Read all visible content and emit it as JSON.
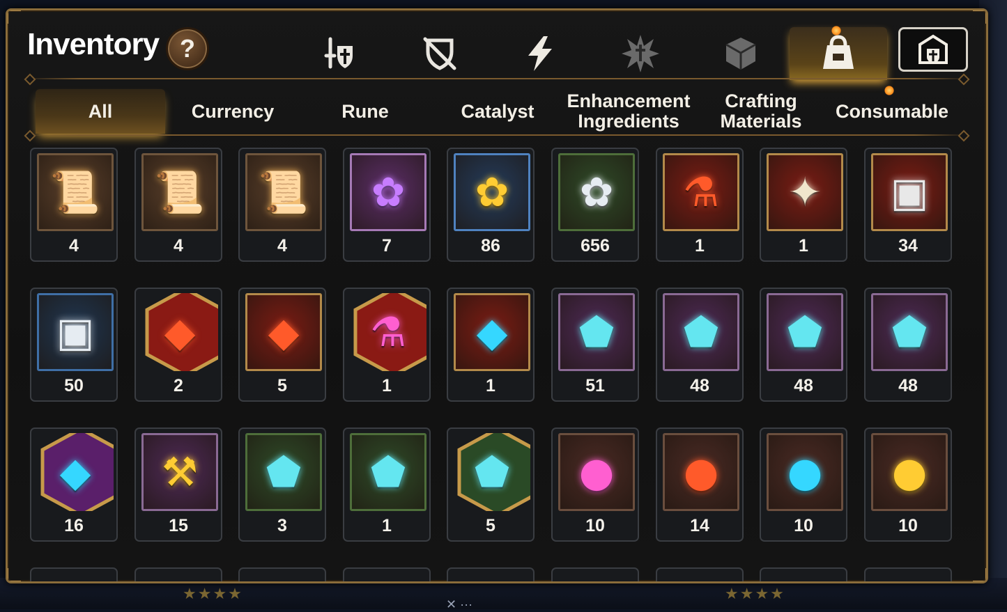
{
  "header": {
    "title": "Inventory",
    "help_label": "?"
  },
  "category_tabs": [
    {
      "name": "hero-equipment",
      "icon": "knight-shield-icon",
      "active": false
    },
    {
      "name": "no-equipment",
      "icon": "crossed-shield-icon",
      "active": false
    },
    {
      "name": "energy",
      "icon": "lightning-icon",
      "active": false
    },
    {
      "name": "artifacts",
      "icon": "burst-icon",
      "active": false
    },
    {
      "name": "materials",
      "icon": "cube-icon",
      "active": false
    },
    {
      "name": "bag",
      "icon": "bag-icon",
      "active": true
    },
    {
      "name": "storage",
      "icon": "vault-icon",
      "active": false
    }
  ],
  "sub_tabs": [
    {
      "label": "All",
      "active": true
    },
    {
      "label": "Currency",
      "active": false
    },
    {
      "label": "Rune",
      "active": false
    },
    {
      "label": "Catalyst",
      "active": false
    },
    {
      "label": "Enhancement\nIngredients",
      "active": false
    },
    {
      "label": "Crafting\nMaterials",
      "active": false
    },
    {
      "label": "Consumable",
      "active": false
    }
  ],
  "items": [
    [
      {
        "icon": "scroll-orange-icon",
        "qty": "4",
        "bg": "#5a3f2a",
        "border": "#6e553c"
      },
      {
        "icon": "scroll-rainbow-icon",
        "qty": "4",
        "bg": "#5a3f2a",
        "border": "#6e553c"
      },
      {
        "icon": "scroll-plain-icon",
        "qty": "4",
        "bg": "#5a3f2a",
        "border": "#6e553c"
      },
      {
        "icon": "purple-flower-icon",
        "qty": "7",
        "bg": "#5b2e66",
        "border": "#a67ab6"
      },
      {
        "icon": "gold-flower-icon",
        "qty": "86",
        "bg": "#243b5a",
        "border": "#4f82c0"
      },
      {
        "icon": "silver-flower-icon",
        "qty": "656",
        "bg": "#2f4a28",
        "border": "#4e6e3a"
      },
      {
        "icon": "red-potion-icon",
        "qty": "1",
        "bg": "#7a1c14",
        "border": "#b38a4a"
      },
      {
        "icon": "star-wand-icon",
        "qty": "1",
        "bg": "#7a1c14",
        "border": "#b38a4a"
      },
      {
        "icon": "treasure-box-icon",
        "qty": "34",
        "bg": "#7a1c14",
        "border": "#b38a4a"
      }
    ],
    [
      {
        "icon": "silver-box-icon",
        "qty": "50",
        "bg": "#203650",
        "border": "#3f6fa6"
      },
      {
        "icon": "red-star-gem-icon",
        "qty": "2",
        "bg": "#8a1a14",
        "border": "#c79a4a",
        "hex": true
      },
      {
        "icon": "fire-hammer-gem-icon",
        "qty": "5",
        "bg": "#7a1c14",
        "border": "#b38a4a"
      },
      {
        "icon": "pink-potion-icon",
        "qty": "1",
        "bg": "#8a1a14",
        "border": "#c79a4a",
        "hex": true
      },
      {
        "icon": "blue-hammer-gem-icon",
        "qty": "1",
        "bg": "#7a1c14",
        "border": "#b38a4a"
      },
      {
        "icon": "sword-stone-icon",
        "qty": "51",
        "bg": "#4e2a55",
        "border": "#8a6a94"
      },
      {
        "icon": "helmet-stone-icon",
        "qty": "48",
        "bg": "#4e2a55",
        "border": "#8a6a94"
      },
      {
        "icon": "armor-stone-icon",
        "qty": "48",
        "bg": "#4e2a55",
        "border": "#8a6a94"
      },
      {
        "icon": "boot-stone-icon",
        "qty": "48",
        "bg": "#4e2a55",
        "border": "#8a6a94"
      }
    ],
    [
      {
        "icon": "cyan-star-gem-icon",
        "qty": "16",
        "bg": "#5a1f6a",
        "border": "#c79a4a",
        "hex": true
      },
      {
        "icon": "gold-hammer-stone-icon",
        "qty": "15",
        "bg": "#4e2a55",
        "border": "#8a6a94"
      },
      {
        "icon": "sword-rock-icon",
        "qty": "3",
        "bg": "#2f4a28",
        "border": "#4e6e3a"
      },
      {
        "icon": "armor-rock-icon",
        "qty": "1",
        "bg": "#2f4a28",
        "border": "#4e6e3a"
      },
      {
        "icon": "star-rock-icon",
        "qty": "5",
        "bg": "#2a4a26",
        "border": "#c79a4a",
        "hex": true
      },
      {
        "icon": "moon-orb-icon",
        "qty": "10",
        "bg": "#4a2a24",
        "border": "#6a4e3e"
      },
      {
        "icon": "fire-orb-icon",
        "qty": "14",
        "bg": "#4a2a24",
        "border": "#6a4e3e"
      },
      {
        "icon": "frost-orb-icon",
        "qty": "10",
        "bg": "#4a2a24",
        "border": "#6a4e3e"
      },
      {
        "icon": "sun-orb-icon",
        "qty": "10",
        "bg": "#4a2a24",
        "border": "#6a4e3e"
      }
    ]
  ],
  "colors": {
    "accent": "#d9a23b",
    "frame": "#8a6c3a",
    "text": "#f4f1ea"
  }
}
